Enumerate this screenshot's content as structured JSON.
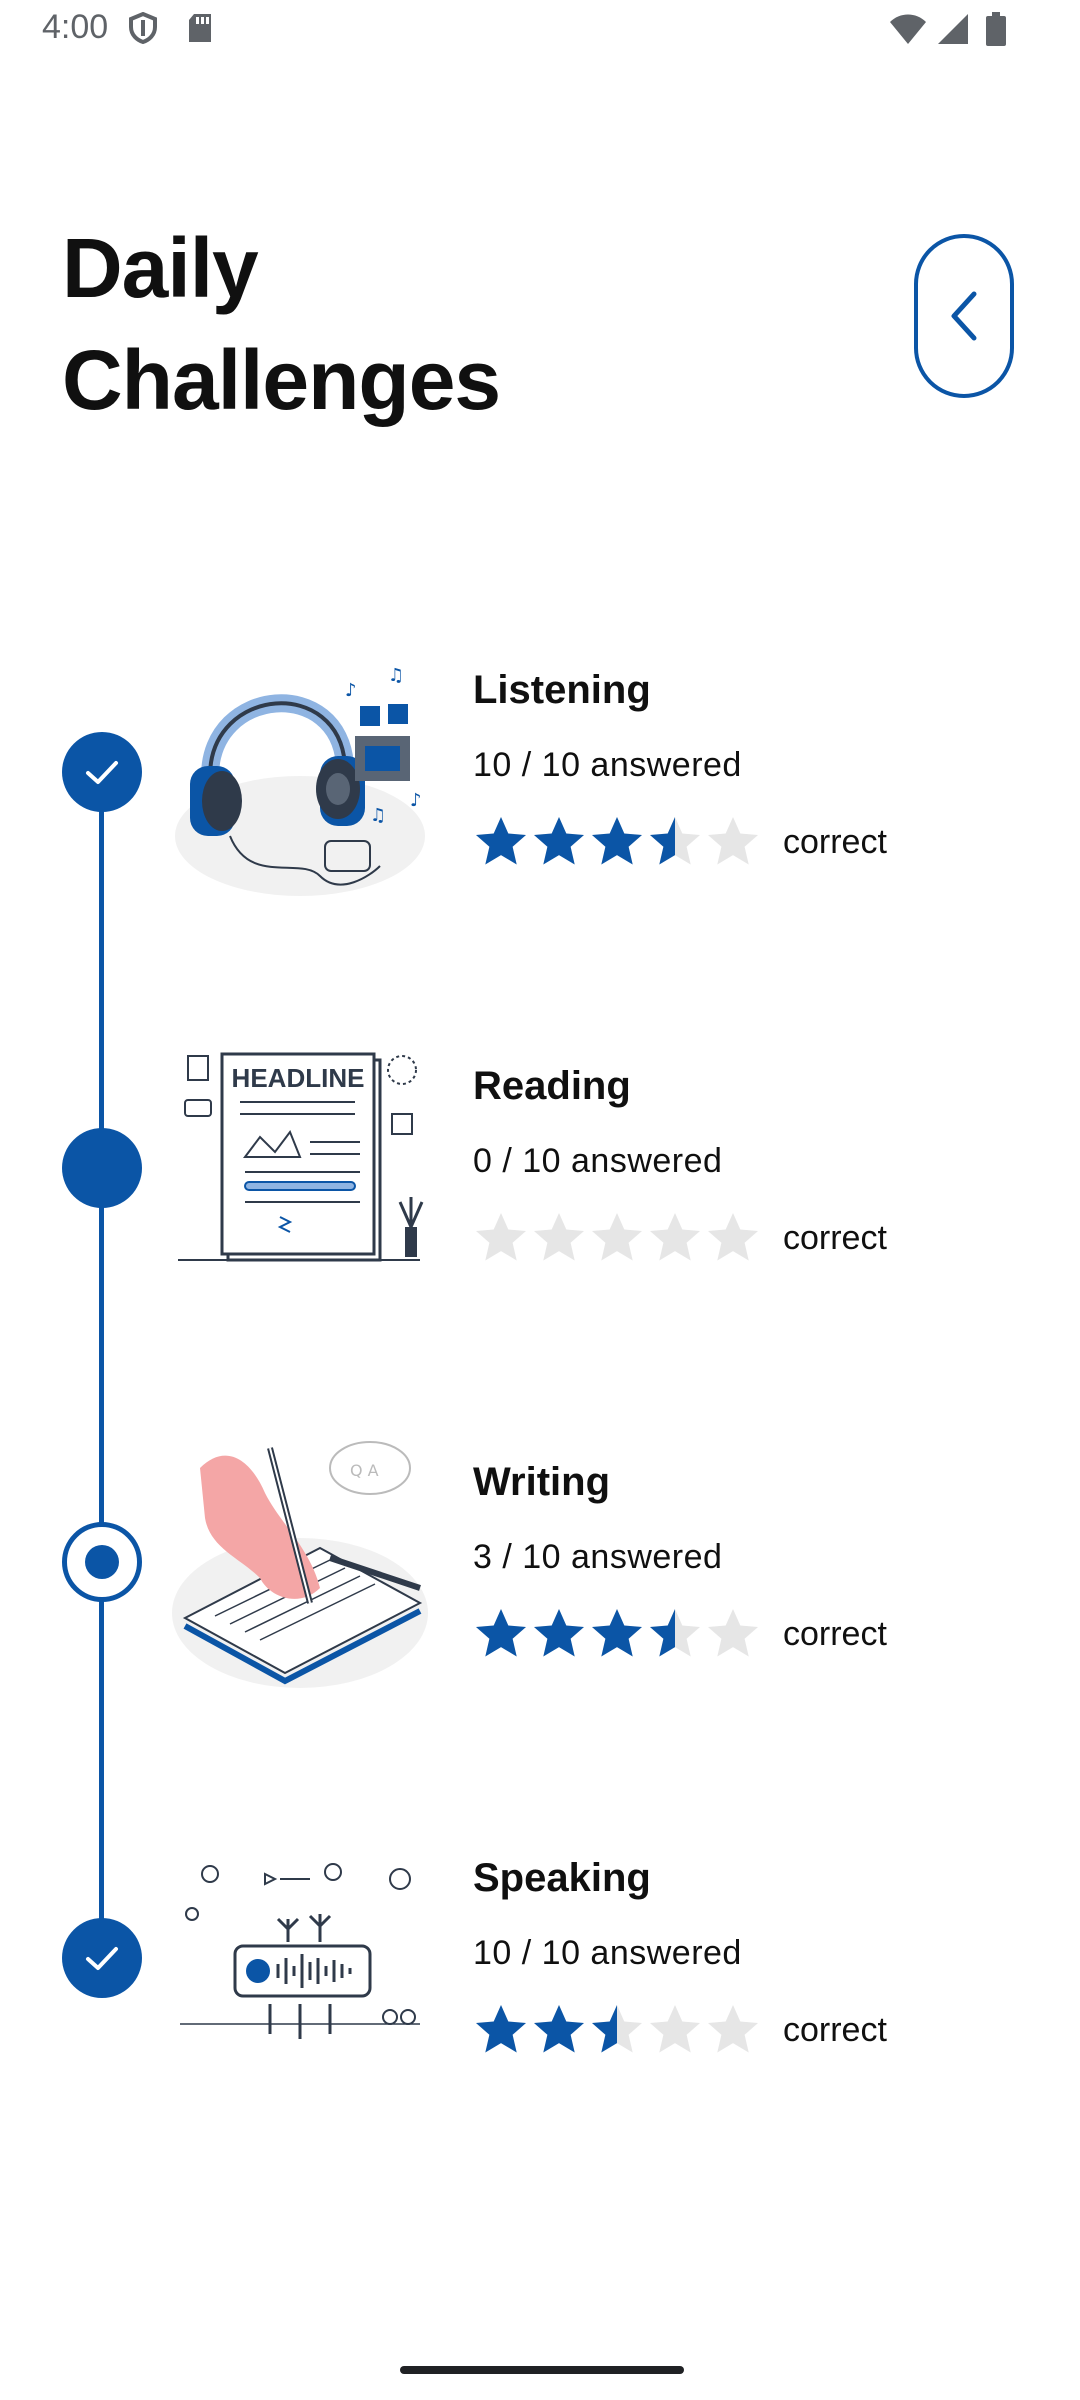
{
  "status_bar": {
    "time": "4:00",
    "icons": [
      "shield-icon",
      "sd-card-icon",
      "wifi-icon",
      "signal-icon",
      "battery-icon"
    ]
  },
  "header": {
    "title_line1": "Daily",
    "title_line2": "Challenges",
    "back_icon": "chevron-left-icon"
  },
  "colors": {
    "accent": "#0B55A6",
    "star_empty": "#E6E6E6"
  },
  "challenges": [
    {
      "name": "Listening",
      "answered": "10 / 10 answered",
      "rating": 3.5,
      "rating_label": "correct",
      "status": "completed",
      "illustration": "headphones-illustration"
    },
    {
      "name": "Reading",
      "answered": "0 / 10 answered",
      "rating": 0,
      "rating_label": "correct",
      "status": "current",
      "illustration": "newspaper-headline-illustration"
    },
    {
      "name": "Writing",
      "answered": "3 / 10 answered",
      "rating": 3.5,
      "rating_label": "correct",
      "status": "in-progress",
      "illustration": "hand-writing-notebook-illustration"
    },
    {
      "name": "Speaking",
      "answered": "10 / 10 answered",
      "rating": 2.5,
      "rating_label": "correct",
      "status": "completed",
      "illustration": "voice-message-illustration"
    }
  ],
  "illustration_texts": {
    "headline": "HEADLINE"
  }
}
